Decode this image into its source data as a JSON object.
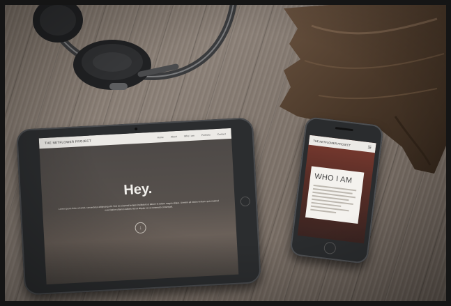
{
  "scene": {
    "background": "wooden plank desk",
    "objects": [
      "headphones",
      "driftwood",
      "tablet",
      "smartphone"
    ]
  },
  "tablet": {
    "brand": "THE NETFLOWER PROJECT",
    "nav_links": [
      "Home",
      "About",
      "Who I am",
      "Portfolio",
      "Contact"
    ],
    "hero_title": "Hey.",
    "body_text": "Lorem ipsum dolor sit amet, consectetur adipiscing elit. Sed do eiusmod tempor incididunt ut labore et dolore magna aliqua. Ut enim ad minim veniam, quis nostrud exercitation ullamco laboris nisi ut aliquip ex ea commodo consequat.",
    "scroll_icon": "arrow-down-circle-icon"
  },
  "phone": {
    "brand": "THE NETFLOWER PROJECT",
    "menu_icon": "hamburger-icon",
    "card_title": "WHO I AM"
  },
  "colors": {
    "frame": "#151515",
    "wood": "#7d7268",
    "device": "#2b2d2f",
    "nav": "#eceae6"
  }
}
